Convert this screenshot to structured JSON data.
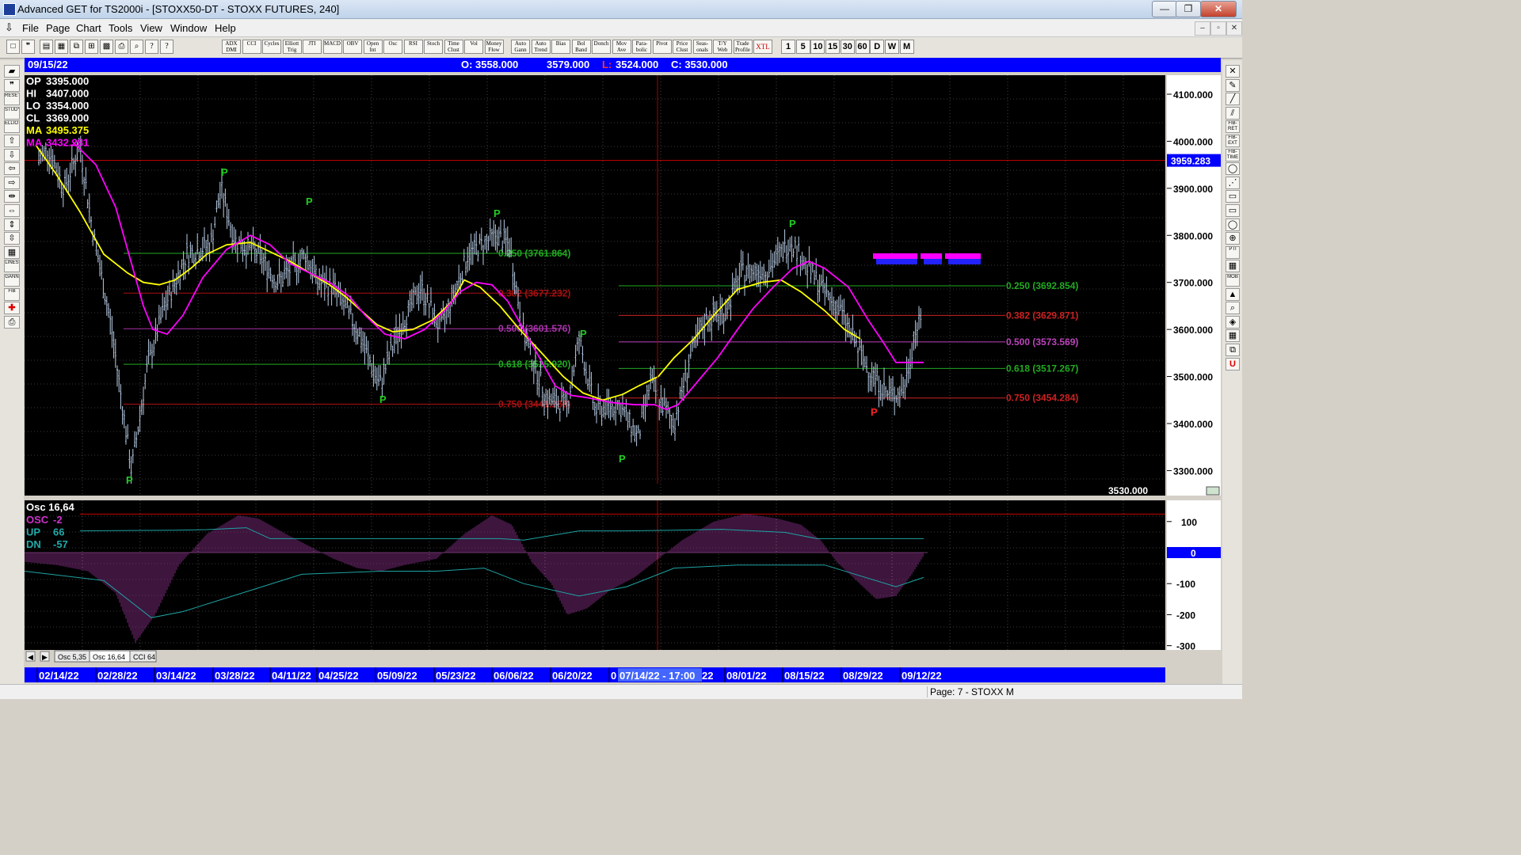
{
  "window": {
    "title": "Advanced GET for TS2000i - [STOXX50-DT - STOXX FUTURES, 240]",
    "buttons": {
      "minimize": "—",
      "maximize": "❐",
      "close": "✕"
    },
    "mdi_buttons": {
      "minimize": "–",
      "restore": "▫",
      "close": "✕"
    }
  },
  "menu": [
    "File",
    "Page",
    "Chart",
    "Tools",
    "View",
    "Window",
    "Help"
  ],
  "toolbar": {
    "file_icons": [
      "new-icon",
      "quote-icon",
      "open-icon",
      "save-icon",
      "copy-icon",
      "layout-icon",
      "grid-icon",
      "print-icon",
      "preview-icon",
      "help-icon",
      "context-help-icon"
    ],
    "studies": [
      "ADX DMI",
      "CCI",
      "Cycles",
      "Elliott Trig",
      "JTI",
      "MACD",
      "OBV",
      "Open Int",
      "Osc",
      "RSI",
      "Stoch",
      "Time Clust",
      "Vol",
      "Money Flow",
      "Auto Gann",
      "Auto Trend",
      "Bias",
      "Bol Band",
      "Donch",
      "Mov Ave",
      "Para-bolic",
      "Pivot",
      "Price Clust",
      "Seas-onals",
      "T/Y Web",
      "Trade Profile",
      "XTL"
    ],
    "timeframes": [
      "1",
      "5",
      "10",
      "15",
      "30",
      "60",
      "D",
      "W",
      "M"
    ]
  },
  "leftbar": [
    "open-folder-icon",
    "quote-icon",
    "reset",
    "study",
    "elliott",
    "arrow-up-icon",
    "arrow-down-icon",
    "arrow-left-icon",
    "arrow-right-icon",
    "expand-x-icon",
    "compress-x-icon",
    "expand-y-icon",
    "compress-y-icon",
    "grid-icon",
    "lines",
    "gann",
    "fib",
    "crosshair-icon",
    "print-icon"
  ],
  "rightbar": [
    "close-icon",
    "pencil-icon",
    "line-icon",
    "parallel-icon",
    "fib-ret",
    "fib-ext",
    "fib-time",
    "ellipse-icon",
    "fan-icon",
    "rect-icon",
    "rect-icon",
    "ellipse-icon",
    "gann-icon",
    "pti",
    "grid-icon",
    "mob",
    "triangle-icon",
    "zoom-icon",
    "paint-icon",
    "calendar-icon",
    "copy-icon",
    "u-icon"
  ],
  "date_bar": {
    "date": "09/15/22",
    "open": "O: 3558.000",
    "high": "3579.000",
    "low_label": "L:",
    "low": "3524.000",
    "close": "C: 3530.000"
  },
  "info_box": [
    {
      "label": "OP",
      "value": "3395.000",
      "color": "#ffffff"
    },
    {
      "label": "HI",
      "value": "3407.000",
      "color": "#ffffff"
    },
    {
      "label": "LO",
      "value": "3354.000",
      "color": "#ffffff"
    },
    {
      "label": "CL",
      "value": "3369.000",
      "color": "#ffffff"
    },
    {
      "label": "MA",
      "value": "3495.375",
      "color": "#ffff00"
    },
    {
      "label": "MA",
      "value": "3432.281",
      "color": "#ff00ff"
    }
  ],
  "price_axis": {
    "ticks": [
      "4100.000",
      "4000.000",
      "3900.000",
      "3800.000",
      "3700.000",
      "3600.000",
      "3500.000",
      "3400.000",
      "3300.000"
    ],
    "highlight": "3959.283",
    "last": "3530.000"
  },
  "fib_levels": [
    {
      "label": "0.250 (3761.864)",
      "color": "#22aa22"
    },
    {
      "label": "0.382 (3677.232)",
      "color": "#aa1111"
    },
    {
      "label": "0.500 (3601.576)",
      "color": "#aa33aa"
    },
    {
      "label": "0.618 (3525.920)",
      "color": "#22aa22"
    },
    {
      "label": "0.750 (3441.288)",
      "color": "#aa1111"
    },
    {
      "label": "0.250 (3692.854)",
      "color": "#22aa22"
    },
    {
      "label": "0.382 (3629.871)",
      "color": "#cc2222"
    },
    {
      "label": "0.500 (3573.569)",
      "color": "#bb44bb"
    },
    {
      "label": "0.618 (3517.267)",
      "color": "#22aa22"
    },
    {
      "label": "0.750 (3454.284)",
      "color": "#cc2222"
    }
  ],
  "pivot_markers": [
    {
      "label": "P",
      "color": "#22cc22"
    },
    {
      "label": "P",
      "color": "#22cc22"
    },
    {
      "label": "P",
      "color": "#22cc22"
    },
    {
      "label": "P",
      "color": "#22cc22"
    },
    {
      "label": "P",
      "color": "#22cc22"
    },
    {
      "label": "P",
      "color": "#22cc22"
    },
    {
      "label": "P",
      "color": "#22cc22"
    },
    {
      "label": "P",
      "color": "#22cc22"
    },
    {
      "label": "P",
      "color": "#ff2222"
    }
  ],
  "oscillator": {
    "title": "Osc 16,64",
    "rows": [
      {
        "label": "OSC",
        "value": "-2",
        "color": "#cc33cc"
      },
      {
        "label": "UP",
        "value": "66",
        "color": "#22aaaa"
      },
      {
        "label": "DN",
        "value": "-57",
        "color": "#22aaaa"
      }
    ],
    "axis_ticks": [
      "100",
      "0",
      "-100",
      "-200",
      "-300"
    ],
    "tabs": [
      "Osc 5,35",
      "Osc 16,64",
      "CCI 64"
    ]
  },
  "date_axis": {
    "labels": [
      "02/14/22",
      "02/28/22",
      "03/14/22",
      "03/28/22",
      "04/11/22",
      "04/25/22",
      "05/09/22",
      "05/23/22",
      "06/06/22",
      "06/20/22",
      "0",
      "22",
      "08/01/22",
      "08/15/22",
      "08/29/22",
      "09/12/22"
    ],
    "cursor": "07/14/22 - 17:00"
  },
  "status": {
    "page": "Page: 7 - STOXX M"
  },
  "colors": {
    "background": "#000000",
    "grid": "#3a3a3a",
    "bars": "#b8cde6",
    "ma_fast": "#ffff00",
    "ma_slow": "#ff00ff",
    "axis_blue": "#0000ff",
    "cursor": "#aa0000"
  }
}
